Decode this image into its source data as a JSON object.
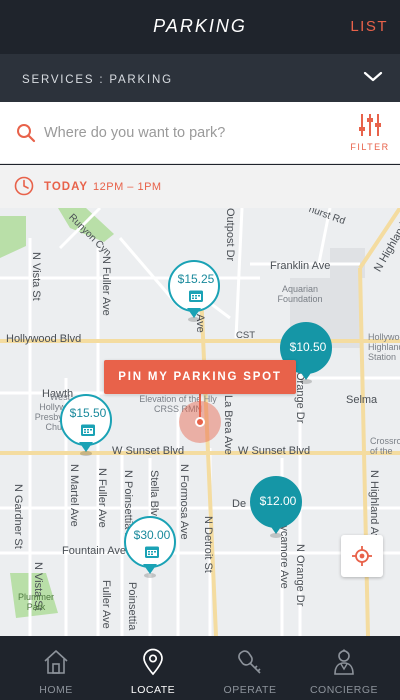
{
  "header": {
    "title": "PARKING",
    "list_label": "LIST"
  },
  "services": {
    "label": "SERVICES : PARKING",
    "chevron_icon": "chevron-down-icon"
  },
  "search": {
    "placeholder": "Where do you want to park?",
    "filter_label": "FILTER"
  },
  "schedule": {
    "day": "TODAY",
    "time": "12PM – 1PM"
  },
  "map": {
    "roads": {
      "runyon": "Runyon Cyn",
      "outpost": "Outpost Dr",
      "hurst": "hurst Rd",
      "highland_top": "N Highland Ave",
      "franklin": "Franklin Ave",
      "vista_top": "N Vista St",
      "fuller_top": "N Fuller Ave",
      "ave_frag": "Ave",
      "hollywood": "Hollywood Blvd",
      "cst": "CST",
      "hawth": "Hawth",
      "selma": "Selma",
      "sunset_w": "W Sunset Blvd",
      "sunset_e": "W Sunset Blvd",
      "la_brea": "N La Brea Ave",
      "orange_top": "Orange Dr",
      "gardner": "N Gardner St",
      "vista_bottom": "N Vista St",
      "martel": "N Martel Ave",
      "fuller_bottom": "N Fuller Ave",
      "poinsettia": "N Poinsettia Pl",
      "stella": "Stella Blvd",
      "formosa": "N Formosa Ave",
      "detroit": "N Detroit St",
      "fountain": "Fountain Ave",
      "de_frag": "De",
      "sycamore": "Sycamore Ave",
      "orange_bottom": "N Orange Dr",
      "highland_bottom": "N Highland Ave",
      "poinsettia_bottom": "Poinsettia",
      "fuller_south": "Fuller Ave"
    },
    "pois": {
      "aquarian": "Aquarian Foundation",
      "elevation": "Elevation of the Hly CRSS RMN",
      "westhollywood": "West Hollywood Presbyterian Church",
      "plummer": "Plummer Park",
      "hollywood_station": "Hollywood Highland Station",
      "crossroads": "Crossro of the"
    },
    "pins": [
      {
        "price": "$15.25",
        "style": "outline",
        "icon": "calendar-icon"
      },
      {
        "price": "$10.50",
        "style": "filled"
      },
      {
        "price": "$15.50",
        "style": "outline",
        "icon": "calendar-icon"
      },
      {
        "price": "$12.00",
        "style": "filled"
      },
      {
        "price": "$30.00",
        "style": "outline",
        "icon": "calendar-icon"
      }
    ],
    "pin_my_spot_label": "PIN MY PARKING SPOT",
    "colors": {
      "accent": "#e8624a",
      "teal": "#1596a6",
      "park": "#b9dfa8"
    }
  },
  "nav": {
    "items": [
      {
        "label": "HOME",
        "icon": "home-icon",
        "active": false
      },
      {
        "label": "LOCATE",
        "icon": "location-pin-icon",
        "active": true
      },
      {
        "label": "OPERATE",
        "icon": "key-icon",
        "active": false
      },
      {
        "label": "CONCIERGE",
        "icon": "concierge-icon",
        "active": false
      }
    ]
  }
}
